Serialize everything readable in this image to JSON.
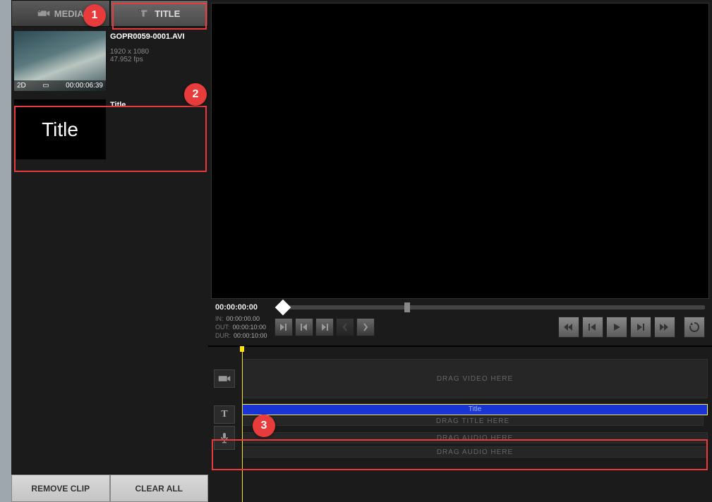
{
  "tabs": {
    "media": {
      "label": "MEDIA"
    },
    "title": {
      "label": "TITLE"
    }
  },
  "assets": {
    "clip": {
      "filename": "GOPR0059-0001.AVI",
      "resolution": "1920 x 1080",
      "fps": "47.952 fps",
      "badge_mode": "2D",
      "badge_tc": "00:00:06:39"
    },
    "title_item": {
      "label": "Title",
      "thumb_text": "Title"
    }
  },
  "bottom": {
    "remove": "REMOVE CLIP",
    "clear": "CLEAR ALL"
  },
  "preview": {
    "scrub_tc": "00:00:00:00",
    "in_label": "IN:",
    "in_tc": "00:00:00.00",
    "out_label": "OUT:",
    "out_tc": "00:00:10:00",
    "dur_label": "DUR:",
    "dur_tc": "00:00:10:00"
  },
  "timeline": {
    "video_hint": "DRAG VIDEO HERE",
    "title_hint": "DRAG TITLE HERE",
    "audio1_hint": "DRAG AUDIO HERE",
    "audio2_hint": "DRAG AUDIO HERE",
    "title_clip_label": "Title"
  },
  "callouts": {
    "n1": "1",
    "n2": "2",
    "n3": "3"
  },
  "icons": {
    "camera": "camera-icon",
    "text": "text-icon",
    "mic": "mic-icon",
    "loop": "loop-icon"
  }
}
